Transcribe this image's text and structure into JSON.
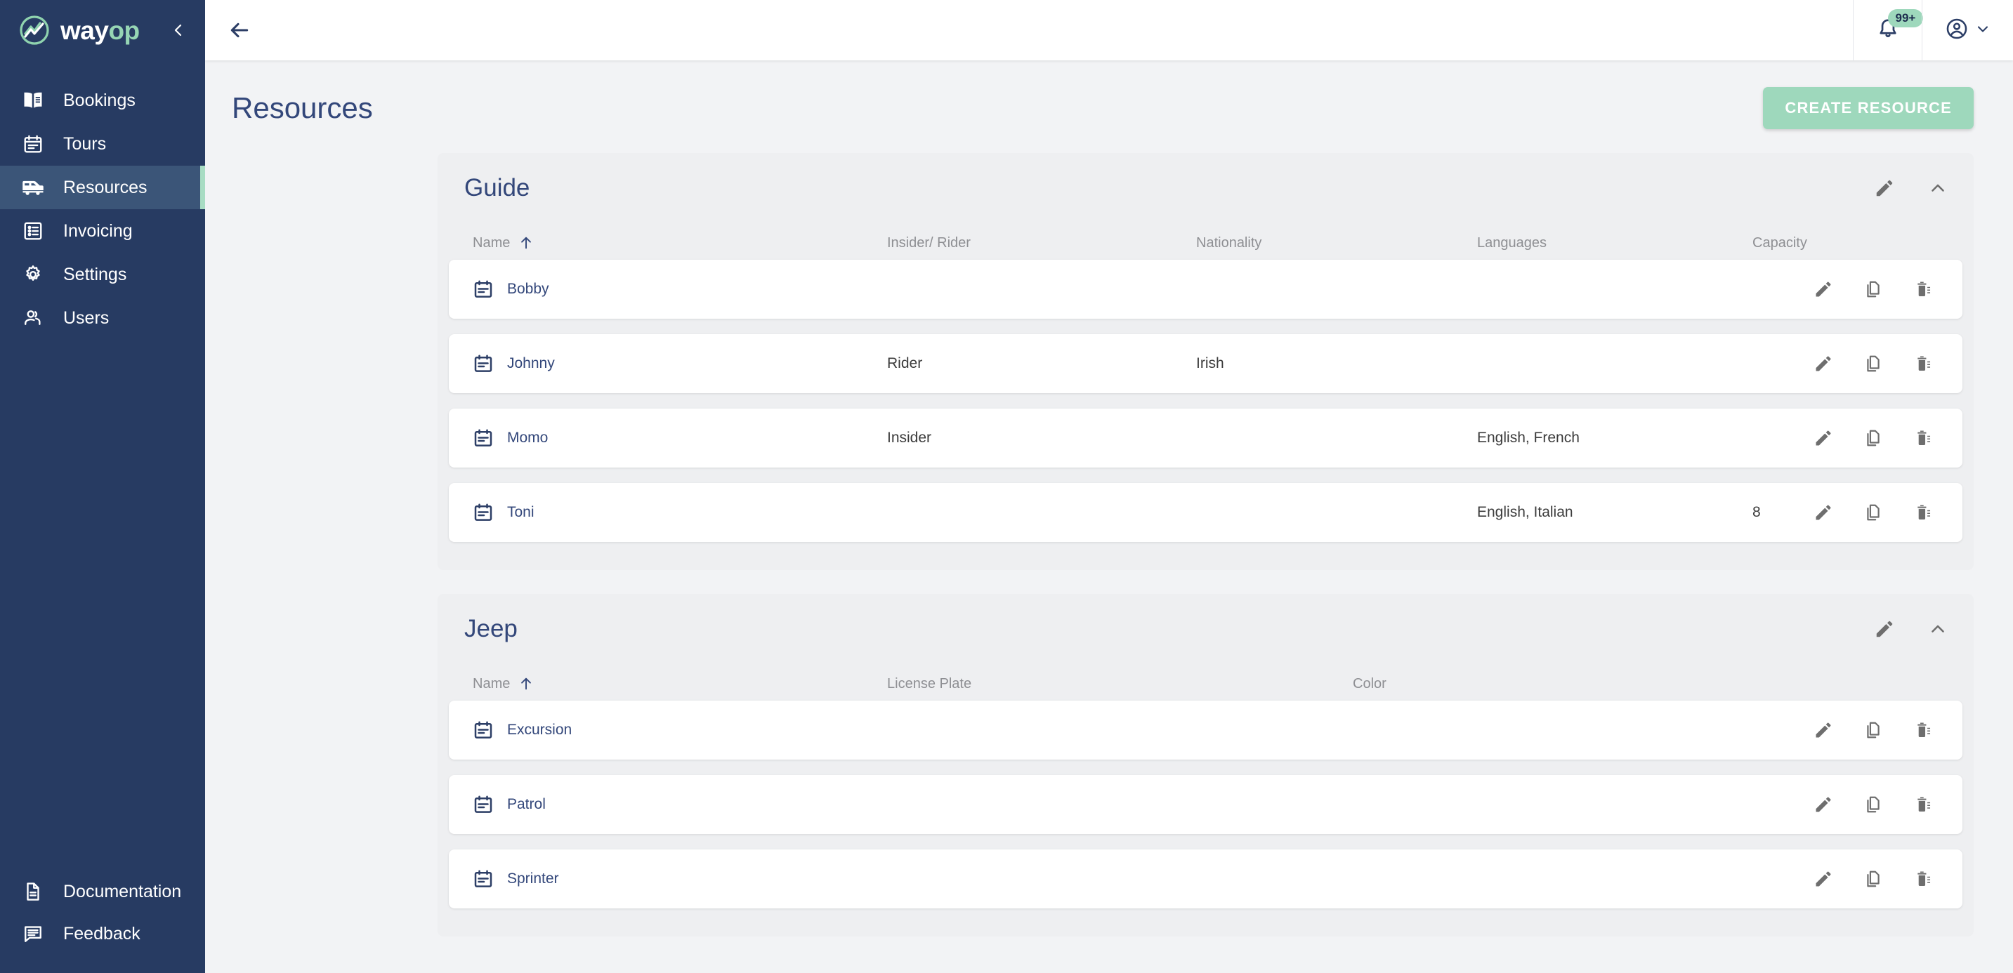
{
  "brand": {
    "name_prefix": "way",
    "name_suffix": "op",
    "logo_icon": "wayop-logo-icon",
    "collapse_icon": "chevron-left-icon"
  },
  "sidebar": {
    "items": [
      {
        "label": "Bookings",
        "icon": "book-icon",
        "active": false
      },
      {
        "label": "Tours",
        "icon": "calendar-icon",
        "active": false
      },
      {
        "label": "Resources",
        "icon": "van-icon",
        "active": true
      },
      {
        "label": "Invoicing",
        "icon": "list-box-icon",
        "active": false
      },
      {
        "label": "Settings",
        "icon": "gear-icon",
        "active": false
      },
      {
        "label": "Users",
        "icon": "users-icon",
        "active": false
      }
    ],
    "bottom_items": [
      {
        "label": "Documentation",
        "icon": "document-icon"
      },
      {
        "label": "Feedback",
        "icon": "comment-icon"
      }
    ]
  },
  "topbar": {
    "back_icon": "arrow-left-icon",
    "notifications": {
      "icon": "bell-icon",
      "badge": "99+"
    },
    "account": {
      "icon": "account-circle-icon",
      "chevron": "chevron-down-icon"
    }
  },
  "page": {
    "title": "Resources",
    "create_button": "CREATE RESOURCE"
  },
  "sections": [
    {
      "title": "Guide",
      "edit_icon": "pencil-icon",
      "collapse_icon": "chevron-up-icon",
      "columns": [
        "Name",
        "Insider/ Rider",
        "Nationality",
        "Languages",
        "Capacity"
      ],
      "sort_column": "Name",
      "sort_direction": "asc",
      "rows": [
        {
          "icon": "event-note-icon",
          "name": "Bobby",
          "insider_rider": "",
          "nationality": "",
          "languages": "",
          "capacity": ""
        },
        {
          "icon": "event-note-icon",
          "name": "Johnny",
          "insider_rider": "Rider",
          "nationality": "Irish",
          "languages": "",
          "capacity": ""
        },
        {
          "icon": "event-note-icon",
          "name": "Momo",
          "insider_rider": "Insider",
          "nationality": "",
          "languages": "English, French",
          "capacity": ""
        },
        {
          "icon": "event-note-icon",
          "name": "Toni",
          "insider_rider": "",
          "nationality": "",
          "languages": "English, Italian",
          "capacity": "8"
        }
      ]
    },
    {
      "title": "Jeep",
      "edit_icon": "pencil-icon",
      "collapse_icon": "chevron-up-icon",
      "columns": [
        "Name",
        "License Plate",
        "Color"
      ],
      "sort_column": "Name",
      "sort_direction": "asc",
      "rows": [
        {
          "icon": "event-note-icon",
          "name": "Excursion",
          "license_plate": "",
          "color": ""
        },
        {
          "icon": "event-note-icon",
          "name": "Patrol",
          "license_plate": "",
          "color": ""
        },
        {
          "icon": "event-note-icon",
          "name": "Sprinter",
          "license_plate": "",
          "color": ""
        }
      ]
    }
  ],
  "row_actions": {
    "edit": "pencil-icon",
    "duplicate": "copy-icon",
    "delete": "trash-icon"
  },
  "colors": {
    "sidebar_bg": "#273b62",
    "sidebar_active_bg": "#3b5578",
    "accent_green": "#9ed8bc",
    "heading_blue": "#33477a",
    "page_bg": "#f2f3f5",
    "card_bg": "#ffffff"
  }
}
